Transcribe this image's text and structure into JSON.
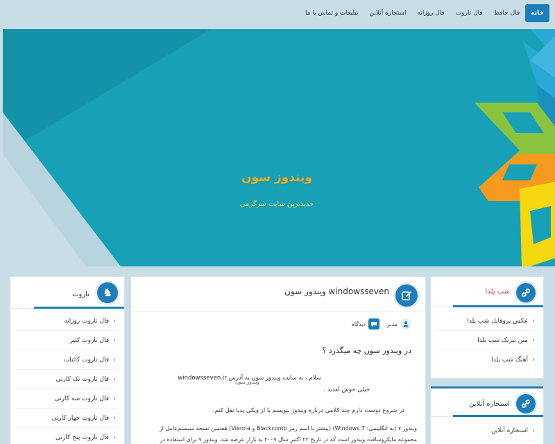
{
  "nav": {
    "items": [
      "خانه",
      "فال حافظ",
      "فال تاروت",
      "فال روزانه",
      "استخاره آنلاین",
      "تبلیغات و تماس با ما"
    ]
  },
  "hero": {
    "title": "ویندوز سون",
    "subtitle": "جدیدترین سایت سرگرمی"
  },
  "right_sidebar": {
    "yalda": {
      "title": "شب یلدا",
      "items": [
        "عکس پروفایل شب یلدا",
        "متن تبریک شب یلدا",
        "آهنگ شب یلدا"
      ]
    },
    "istikhara": {
      "title": "استخاره آنلاین",
      "items": [
        "استخاره آنلاین"
      ]
    }
  },
  "main": {
    "title": "ویندوز سون windowsseven",
    "author": "مدیر",
    "comments": "دیدگاه",
    "post_heading": "در ویندوز سون چه میگذرد ؟",
    "image_alt": "ویندوز سون",
    "p1_line1": "سلام ، به سایت ویندوز سون به آدرس windowsseven.ir",
    "p1_line2": "خیلی خوش آمدید .",
    "p2": "در شروع دوست دارم چند کلامی درباره ویندوز بنویسم یا از ویکی پدیا نقل کنم.",
    "p3_line1": "ویندوز ۷ (به انگلیسی: Windows 7) (پیشتر با اسم رمز Blackcomb و Vienna) هفتمین نسخه سیستم‌عامل از",
    "p3_line2": "مجموعه مایکروسافت ویندوز است که در تاریخ ۲۲ اکتبر سال ۲۰۰۹ به بازار عرضه شد. ویندوز ۷ برای استفاده در"
  },
  "left_sidebar": {
    "tarot": {
      "title": "تاروت",
      "items": [
        "فال تاروت روزانه",
        "فال تاروت کبیر",
        "فال تاروت کائنات",
        "فال تاروت تک کارتی",
        "فال تاروت سه کارتی",
        "فال تاروت چهار کارتی",
        "فال تاروت پنج کارتی"
      ]
    }
  },
  "colors": {
    "accent": "#1e7db8",
    "hero_bg": "#17a0b6",
    "title_orange": "#f3a81f",
    "yalda_red": "#d9302b"
  }
}
